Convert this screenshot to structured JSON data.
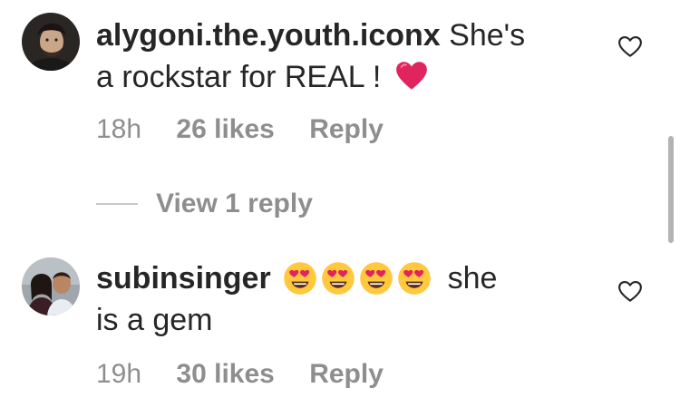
{
  "comments": [
    {
      "username": "alygoni.the.youth.iconx",
      "text_line1": "She's",
      "text_line2": "a rockstar for REAL !",
      "time": "18h",
      "likes": "26 likes",
      "reply_label": "Reply",
      "view_replies_label": "View 1 reply"
    },
    {
      "username": "subinsinger",
      "text_after_emojis": "she",
      "text_line2": "is a gem",
      "time": "19h",
      "likes": "30 likes",
      "reply_label": "Reply"
    }
  ],
  "icons": {
    "like": "heart-outline-icon",
    "heart_emoji": "red-heart-emoji",
    "love_emoji": "heart-eyes-emoji"
  },
  "colors": {
    "text": "#262626",
    "secondary": "#8e8e8e",
    "heart": "#e0245e"
  }
}
